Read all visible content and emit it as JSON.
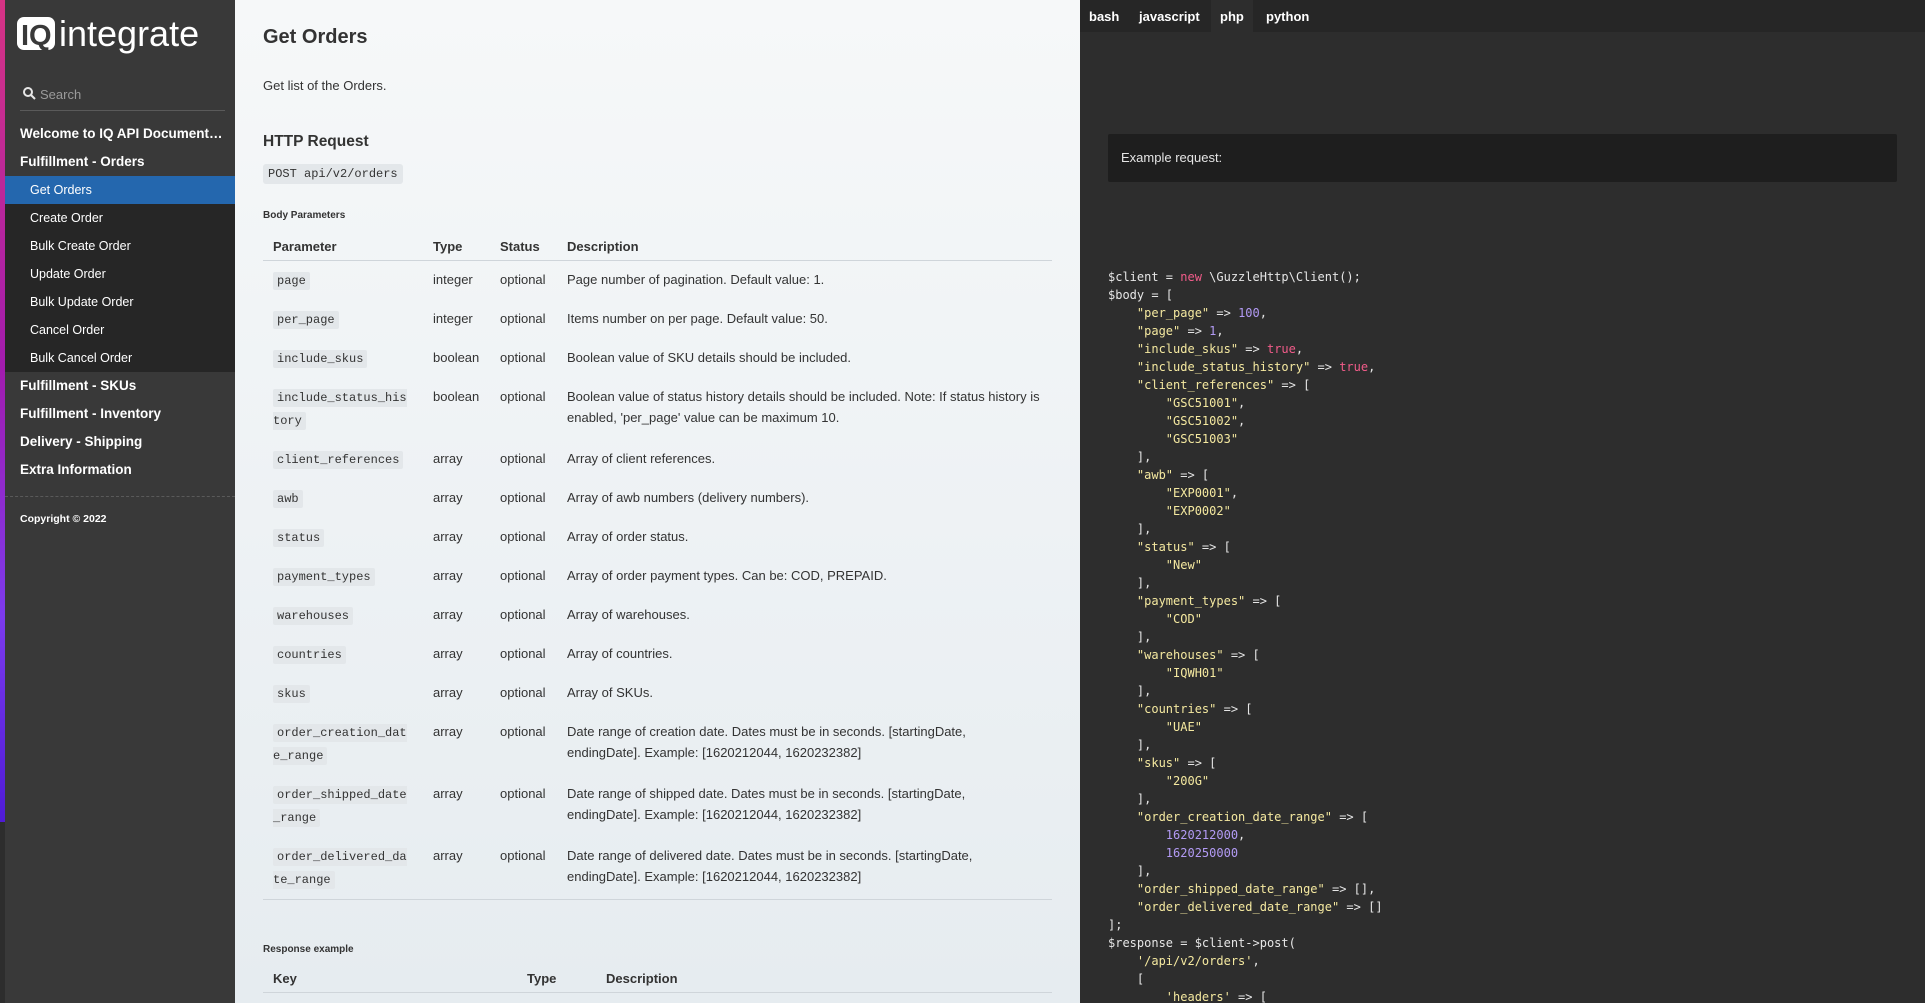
{
  "sidebar": {
    "logo_text": "IQintegrate",
    "search_placeholder": "Search",
    "nav": [
      {
        "label": "Welcome to IQ API Documentation"
      },
      {
        "label": "Fulfillment - Orders",
        "children": [
          {
            "label": "Get Orders",
            "active": true
          },
          {
            "label": "Create Order"
          },
          {
            "label": "Bulk Create Order"
          },
          {
            "label": "Update Order"
          },
          {
            "label": "Bulk Update Order"
          },
          {
            "label": "Cancel Order"
          },
          {
            "label": "Bulk Cancel Order"
          }
        ]
      },
      {
        "label": "Fulfillment - SKUs"
      },
      {
        "label": "Fulfillment - Inventory"
      },
      {
        "label": "Delivery - Shipping"
      },
      {
        "label": "Extra Information"
      }
    ],
    "copyright": "Copyright © 2022"
  },
  "main": {
    "title": "Get Orders",
    "intro": "Get list of the Orders.",
    "http_heading": "HTTP Request",
    "endpoint": "POST api/v2/orders",
    "body_params_label": "Body Parameters",
    "params_headers": [
      "Parameter",
      "Type",
      "Status",
      "Description"
    ],
    "params": [
      {
        "name": "page",
        "type": "integer",
        "status": "optional",
        "description": "Page number of pagination. Default value: 1."
      },
      {
        "name": "per_page",
        "type": "integer",
        "status": "optional",
        "description": "Items number on per page. Default value: 50."
      },
      {
        "name": "include_skus",
        "type": "boolean",
        "status": "optional",
        "description": "Boolean value of SKU details should be included."
      },
      {
        "name": "include_status_history",
        "type": "boolean",
        "status": "optional",
        "description": "Boolean value of status history details should be included. Note: If status history is enabled, 'per_page' value can be maximum 10."
      },
      {
        "name": "client_references",
        "type": "array",
        "status": "optional",
        "description": "Array of client references."
      },
      {
        "name": "awb",
        "type": "array",
        "status": "optional",
        "description": "Array of awb numbers (delivery numbers)."
      },
      {
        "name": "status",
        "type": "array",
        "status": "optional",
        "description": "Array of order status."
      },
      {
        "name": "payment_types",
        "type": "array",
        "status": "optional",
        "description": "Array of order payment types. Can be: COD, PREPAID."
      },
      {
        "name": "warehouses",
        "type": "array",
        "status": "optional",
        "description": "Array of warehouses."
      },
      {
        "name": "countries",
        "type": "array",
        "status": "optional",
        "description": "Array of countries."
      },
      {
        "name": "skus",
        "type": "array",
        "status": "optional",
        "description": "Array of SKUs."
      },
      {
        "name": "order_creation_date_range",
        "type": "array",
        "status": "optional",
        "description": "Date range of creation date. Dates must be in seconds. [startingDate, endingDate]. Example: [1620212044, 1620232382]"
      },
      {
        "name": "order_shipped_date_range",
        "type": "array",
        "status": "optional",
        "description": "Date range of shipped date. Dates must be in seconds. [startingDate, endingDate]. Example: [1620212044, 1620232382]"
      },
      {
        "name": "order_delivered_date_range",
        "type": "array",
        "status": "optional",
        "description": "Date range of delivered date. Dates must be in seconds. [startingDate, endingDate]. Example: [1620212044, 1620232382]"
      }
    ],
    "response_label": "Response example",
    "response_headers": [
      "Key",
      "Type",
      "Description"
    ]
  },
  "code_panel": {
    "tabs": [
      {
        "label": "bash"
      },
      {
        "label": "javascript"
      },
      {
        "label": "php",
        "active": true
      },
      {
        "label": "python"
      }
    ],
    "example_label": "Example request:",
    "code_lines": [
      [
        [
          "p",
          "$client = "
        ],
        [
          "k",
          "new"
        ],
        [
          "p",
          " \\GuzzleHttp\\Client();"
        ]
      ],
      [
        [
          "p",
          "$body = ["
        ]
      ],
      [
        [
          "p",
          "    "
        ],
        [
          "s",
          "\"per_page\""
        ],
        [
          "p",
          " => "
        ],
        [
          "n",
          "100"
        ],
        [
          "p",
          ","
        ]
      ],
      [
        [
          "p",
          "    "
        ],
        [
          "s",
          "\"page\""
        ],
        [
          "p",
          " => "
        ],
        [
          "n",
          "1"
        ],
        [
          "p",
          ","
        ]
      ],
      [
        [
          "p",
          "    "
        ],
        [
          "s",
          "\"include_skus\""
        ],
        [
          "p",
          " => "
        ],
        [
          "k",
          "true"
        ],
        [
          "p",
          ","
        ]
      ],
      [
        [
          "p",
          "    "
        ],
        [
          "s",
          "\"include_status_history\""
        ],
        [
          "p",
          " => "
        ],
        [
          "k",
          "true"
        ],
        [
          "p",
          ","
        ]
      ],
      [
        [
          "p",
          "    "
        ],
        [
          "s",
          "\"client_references\""
        ],
        [
          "p",
          " => ["
        ]
      ],
      [
        [
          "p",
          "        "
        ],
        [
          "s",
          "\"GSC51001\""
        ],
        [
          "p",
          ","
        ]
      ],
      [
        [
          "p",
          "        "
        ],
        [
          "s",
          "\"GSC51002\""
        ],
        [
          "p",
          ","
        ]
      ],
      [
        [
          "p",
          "        "
        ],
        [
          "s",
          "\"GSC51003\""
        ]
      ],
      [
        [
          "p",
          "    ],"
        ]
      ],
      [
        [
          "p",
          "    "
        ],
        [
          "s",
          "\"awb\""
        ],
        [
          "p",
          " => ["
        ]
      ],
      [
        [
          "p",
          "        "
        ],
        [
          "s",
          "\"EXP0001\""
        ],
        [
          "p",
          ","
        ]
      ],
      [
        [
          "p",
          "        "
        ],
        [
          "s",
          "\"EXP0002\""
        ]
      ],
      [
        [
          "p",
          "    ],"
        ]
      ],
      [
        [
          "p",
          "    "
        ],
        [
          "s",
          "\"status\""
        ],
        [
          "p",
          " => ["
        ]
      ],
      [
        [
          "p",
          "        "
        ],
        [
          "s",
          "\"New\""
        ]
      ],
      [
        [
          "p",
          "    ],"
        ]
      ],
      [
        [
          "p",
          "    "
        ],
        [
          "s",
          "\"payment_types\""
        ],
        [
          "p",
          " => ["
        ]
      ],
      [
        [
          "p",
          "        "
        ],
        [
          "s",
          "\"COD\""
        ]
      ],
      [
        [
          "p",
          "    ],"
        ]
      ],
      [
        [
          "p",
          "    "
        ],
        [
          "s",
          "\"warehouses\""
        ],
        [
          "p",
          " => ["
        ]
      ],
      [
        [
          "p",
          "        "
        ],
        [
          "s",
          "\"IQWH01\""
        ]
      ],
      [
        [
          "p",
          "    ],"
        ]
      ],
      [
        [
          "p",
          "    "
        ],
        [
          "s",
          "\"countries\""
        ],
        [
          "p",
          " => ["
        ]
      ],
      [
        [
          "p",
          "        "
        ],
        [
          "s",
          "\"UAE\""
        ]
      ],
      [
        [
          "p",
          "    ],"
        ]
      ],
      [
        [
          "p",
          "    "
        ],
        [
          "s",
          "\"skus\""
        ],
        [
          "p",
          " => ["
        ]
      ],
      [
        [
          "p",
          "        "
        ],
        [
          "s",
          "\"200G\""
        ]
      ],
      [
        [
          "p",
          "    ],"
        ]
      ],
      [
        [
          "p",
          "    "
        ],
        [
          "s",
          "\"order_creation_date_range\""
        ],
        [
          "p",
          " => ["
        ]
      ],
      [
        [
          "p",
          "        "
        ],
        [
          "n",
          "1620212000"
        ],
        [
          "p",
          ","
        ]
      ],
      [
        [
          "p",
          "        "
        ],
        [
          "n",
          "1620250000"
        ]
      ],
      [
        [
          "p",
          "    ],"
        ]
      ],
      [
        [
          "p",
          "    "
        ],
        [
          "s",
          "\"order_shipped_date_range\""
        ],
        [
          "p",
          " => [],"
        ]
      ],
      [
        [
          "p",
          "    "
        ],
        [
          "s",
          "\"order_delivered_date_range\""
        ],
        [
          "p",
          " => []"
        ]
      ],
      [
        [
          "p",
          "];"
        ]
      ],
      [
        [
          "p",
          "$response = $client->post("
        ]
      ],
      [
        [
          "p",
          "    "
        ],
        [
          "s",
          "'/api/v2/orders'"
        ],
        [
          "p",
          ","
        ]
      ],
      [
        [
          "p",
          "    ["
        ]
      ],
      [
        [
          "p",
          "        "
        ],
        [
          "s",
          "'headers'"
        ],
        [
          "p",
          " => ["
        ]
      ]
    ]
  }
}
